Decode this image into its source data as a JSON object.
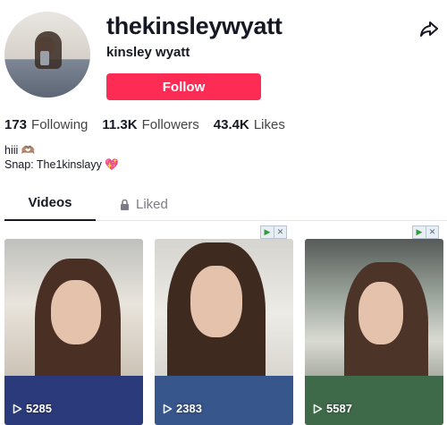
{
  "profile": {
    "username": "thekinsleywyatt",
    "display_name": "kinsley wyatt",
    "follow_label": "Follow",
    "avatar_icon": "profile-photo",
    "share_icon": "share-arrow-icon"
  },
  "stats": [
    {
      "value": "173",
      "label": "Following"
    },
    {
      "value": "11.3K",
      "label": "Followers"
    },
    {
      "value": "43.4K",
      "label": "Likes"
    }
  ],
  "bio": {
    "line1": "hiii 🫶🏽",
    "line2": "Snap: The1kinslayy 💖"
  },
  "tabs": {
    "videos": "Videos",
    "liked": "Liked"
  },
  "videos": [
    {
      "views": "5285"
    },
    {
      "views": "2383"
    },
    {
      "views": "5587"
    }
  ],
  "colors": {
    "accent": "#fe2c55",
    "text": "#161823",
    "muted": "#7c7d84"
  }
}
